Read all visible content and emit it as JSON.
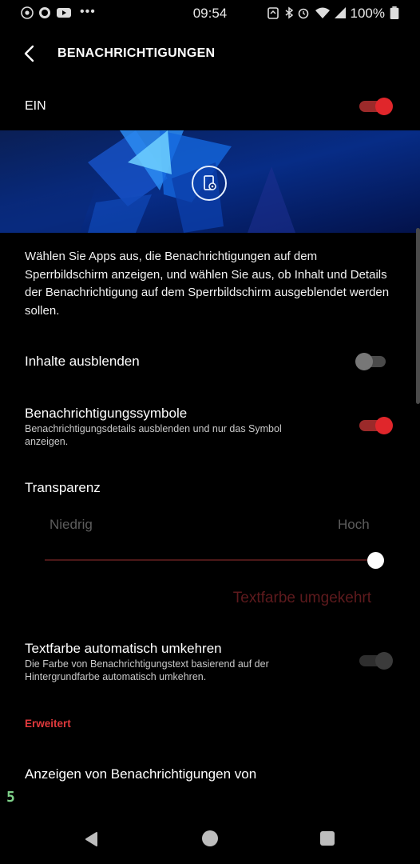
{
  "status_bar": {
    "time": "09:54",
    "battery_percent": "100%",
    "left_icons": [
      "chrome-icon",
      "whatsapp-icon",
      "youtube-icon",
      "more-dots-icon"
    ],
    "right_icons": [
      "nfc-icon",
      "bluetooth-icon",
      "alarm-icon",
      "wifi-icon",
      "signal-icon",
      "battery-icon"
    ]
  },
  "header": {
    "title": "BENACHRICHTIGUNGEN"
  },
  "master_switch": {
    "label": "EIN",
    "state": true,
    "accent": "#e0262b"
  },
  "description": "Wählen Sie Apps aus, die Benachrichtigungen auf dem Sperrbildschirm anzeigen, und wählen Sie aus, ob Inhalt und Details der Benachrichtigung auf dem Sperrbildschirm ausgeblendet werden sollen.",
  "settings": {
    "hide_content": {
      "label": "Inhalte ausblenden",
      "state": false
    },
    "notification_icons": {
      "label": "Benachrichtigungssymbole",
      "sub": "Benachrichtigungsdetails ausblenden und nur das Symbol anzeigen.",
      "state": true
    },
    "transparency": {
      "label": "Transparenz",
      "low": "Niedrig",
      "high": "Hoch",
      "value": 1.0
    },
    "invert_text_color_preview": "Textfarbe umgekehrt",
    "auto_invert": {
      "label": "Textfarbe automatisch umkehren",
      "sub": "Die Farbe von Benachrichtigungstext basierend auf der Hintergrundfarbe automatisch umkehren.",
      "state": true,
      "enabled": false
    }
  },
  "advanced": {
    "section_label": "Erweitert",
    "show_from": "Anzeigen von Benachrichtigungen von"
  },
  "side_number": "5",
  "nav": [
    "back-icon",
    "home-icon",
    "recents-icon"
  ]
}
